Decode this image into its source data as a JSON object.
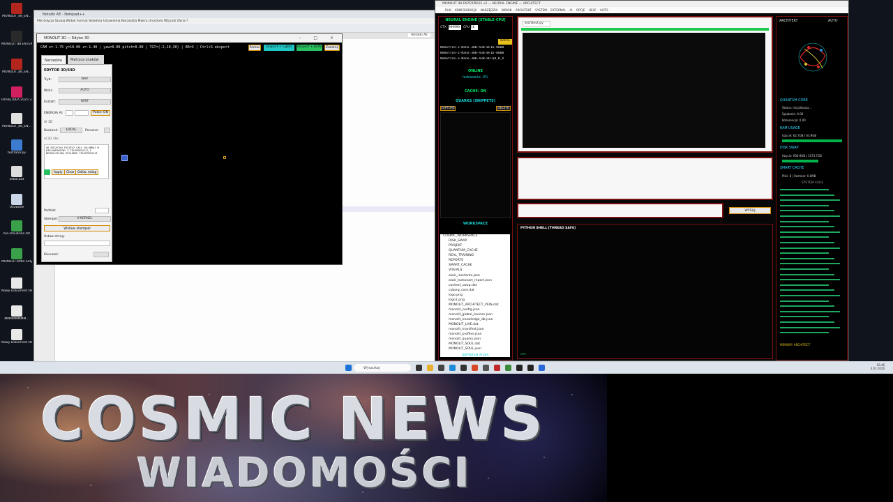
{
  "notepad": {
    "title": "Notatki AE - Notepad++",
    "menu": "Plik  Edycja  Szukaj  Widok  Format  Składnia  Ustawienia  Narzędzia  Makra  Uruchom  Wtyczki  Okna  ?",
    "tab_label": "Notatki AE"
  },
  "editor": {
    "title": "MONOLIT 3D — Edytor 3D",
    "status": "CAM x=-1.75 y=10.00 z=-1.40 | yaw=0.00 pitch=0.00 | TGT=(-2,10,30) | BR=X | Ctrl+S eksport",
    "buttons": {
      "help": "Pomoc",
      "export_lights": "Eksport + Lights",
      "export_json": "Eksport + JSON",
      "close": "Zamknij"
    },
    "tabs": [
      "Narzędzia",
      "Matryca znaków"
    ],
    "panel": {
      "heading": "EDYTOR 3D/64D",
      "mode_label": "Tryb:",
      "mode_value": "NAV",
      "size_label": "Wzór:",
      "size_value": "AUTO",
      "shape_label": "Kształt:",
      "shape_value": "WIRF",
      "energy_label": "ENERGIA AI:",
      "energy_pulse": "Pulse: ON",
      "ai_label": "AI 3D",
      "backend_label": "Backend:",
      "backend_value": "LOCAL",
      "persona_label": "Persona:",
      "ai_status": "AI 3D: Idle",
      "prompt_text": "OD POCZĄTKU PISZESZ CAŁY SOLUBRAI W WIELOKRYWIZNY Z TELEPORTACJĄ I BEZKOLIZYJNĄ MYŚLENIE TELEPORTACJI",
      "btn_apply": "Apply",
      "btn_clear": "Clear",
      "btn_odsw": "Odśw. mózg",
      "split_label": "Podział:",
      "stamp_label": "Stempel:",
      "stamp_value": "X-KERNEL",
      "insert_stamp": "Wstaw stempel",
      "set_string_label": "Ustaw string:",
      "direction_label": "Kierunek:"
    }
  },
  "app": {
    "title": "MONOLIT IBI ENTERPRISE v3 — NEURAL ENGINE — ARCHITECT",
    "menu": "PLIK  KONFIGURACJA  NARZĘDZIA  WIDOK  ARCHITEKT  SYSTEM  EXTERNAL AI  OPCJE  HELP  AUTO",
    "left": {
      "engine_head": "NEURAL ENGINE [STABLE-CPU]",
      "ctx_label": "CTX",
      "ctx_value": "999999",
      "cpu_label": "CPU",
      "cpu_value": "16",
      "ignite": "IGNITE",
      "models": [
        "Nemotron-3-Nano-30B-A3B-BF16-0000",
        "Nemotron-3-Nano-30B-A3B-BF16-0000",
        "Nemotron-3-Nano-30B-A3B-UD-Q8_K_X"
      ],
      "online": "ONLINE",
      "loading": "ładowanie: 0%",
      "cache": "CACHE: ON",
      "quarks_head": "QUARKS (SNIPPETS)",
      "capture": "CAPTURE",
      "delete": "DELETE",
      "workspace_head": "WORKSPACE",
      "refresh": "REFRESH FILES",
      "tree": [
        "COSMIC_WORKSPACE",
        "DISK_SWAP",
        "PROJEKT",
        "QUANTUM_CACHE",
        "REAL_TRAINING",
        "REPORTS",
        "SMART_CACHE",
        "VISUALS",
        "aiwir_incidents.json",
        "aiwir_turbocart_report.json",
        "context_swap.dat",
        "cyborg_core.dat",
        "logo.png",
        "logo1.png",
        "MONOLIT_ARCHITECT_VEIN.dat",
        "monolit_config.json",
        "monolit_global_lexicon.json",
        "monolit_knowledge_db.json",
        "MONOLIT_LIVE.dat",
        "monolit_manifest.json",
        "monolit_profiles.json",
        "monolit_quarks.json",
        "MONOLIT_SOUL.dat",
        "MONOLIT_SOUL.json"
      ]
    },
    "mid": {
      "file_tab": "architect.py",
      "send": "WYŚLIJ",
      "shell_head": "PYTHON SHELL [THREAD SAFE]",
      "prompt": ">>>"
    },
    "right": {
      "arch_label": "ARCHITEKT",
      "auto_label": "AUTO",
      "quantum_head": "QUANTUM CORE",
      "quantum_status": "Status: inicjalizacja...",
      "quantum_line2": "Splątanie: 0.00",
      "quantum_line3": "Koherencja: 0.00",
      "ram_head": "RAM USAGE",
      "ram_value": "Użycie: 62.7GB / 63.9GB",
      "ram_fraction": 0.98,
      "disk_head": "DISK SWAP",
      "disk_value": "Użycie: 930.9GB / 1573.7GB",
      "disk_fraction": 0.59,
      "smart_head": "SMART CACHE",
      "smart_value": "Pliki: 8 | Rozmiar: 0.0MB",
      "logs_head": "SYSTEM LOGS",
      "memory_head": "MEMORY ARCHITECT"
    }
  },
  "taskbar": {
    "search_placeholder": "Wyszukaj",
    "time": "16:46",
    "date": "4.01.2026"
  },
  "banner": {
    "title": "COSMIC NEWS",
    "subtitle": "WIADOMOŚCI"
  },
  "desktop_icons": [
    "MONOLIT_IBI_EN...",
    "MONOLIT IBI ENTERPRISE",
    "MONOLIT_IBI_EN...",
    "IntelliJ IDEA 2025.3.1",
    "MONOLIT_IBI_EN...",
    "testrator.py",
    "zebal.bat",
    "Usuwane",
    "bio-zzoubrion.txt",
    "MONOLIT-AMIR antyvirus mod...",
    "Nowy Dokument tekstowy (4).txt",
    "MMMMMMMM...",
    "Nowy Dokument tekstowy (5).txt.py"
  ]
}
